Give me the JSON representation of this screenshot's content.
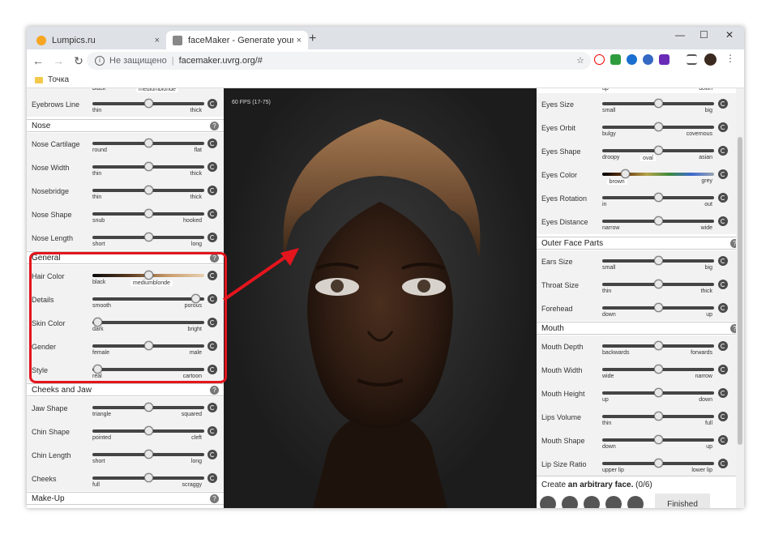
{
  "browser": {
    "tabs": [
      {
        "label": "Lumpics.ru",
        "close": "×"
      },
      {
        "label": "faceMaker - Generate your favou",
        "close": "×"
      }
    ],
    "new_tab": "+",
    "window_controls": {
      "minimize": "—",
      "maximize": "☐",
      "close": "✕"
    },
    "security_label": "Не защищено",
    "url": "facemaker.uvrg.org/#",
    "bookmark": "Точка"
  },
  "viewport": {
    "fps": "60 FPS (17-75)"
  },
  "left_panel": {
    "top_partial": {
      "lo": "black",
      "tooltip": "mediumblonde"
    },
    "eyebrows": {
      "name": "Eyebrows Line",
      "lo": "thin",
      "hi": "thick",
      "value": 0.5
    },
    "nose": {
      "title": "Nose",
      "rows": [
        {
          "name": "Nose Cartilage",
          "lo": "round",
          "hi": "flat",
          "value": 0.5
        },
        {
          "name": "Nose Width",
          "lo": "thin",
          "hi": "thick",
          "value": 0.5
        },
        {
          "name": "Nosebridge",
          "lo": "thin",
          "hi": "thick",
          "value": 0.5
        },
        {
          "name": "Nose Shape",
          "lo": "snub",
          "hi": "hooked",
          "value": 0.5
        },
        {
          "name": "Nose Length",
          "lo": "short",
          "hi": "long",
          "value": 0.5
        }
      ]
    },
    "general": {
      "title": "General",
      "rows": [
        {
          "name": "Hair Color",
          "lo": "black",
          "hi": "",
          "tooltip": "mediumblonde",
          "value": 0.5
        },
        {
          "name": "Details",
          "lo": "smooth",
          "hi": "porous",
          "value": 0.92
        },
        {
          "name": "Skin Color",
          "lo": "dark",
          "hi": "bright",
          "value": 0.04
        },
        {
          "name": "Gender",
          "lo": "female",
          "hi": "male",
          "value": 0.5
        },
        {
          "name": "Style",
          "lo": "real",
          "hi": "cartoon",
          "value": 0.04
        }
      ]
    },
    "cheeks": {
      "title": "Cheeks and Jaw",
      "rows": [
        {
          "name": "Jaw Shape",
          "lo": "triangle",
          "hi": "squared",
          "value": 0.5
        },
        {
          "name": "Chin Shape",
          "lo": "pointed",
          "hi": "cleft",
          "value": 0.5
        },
        {
          "name": "Chin Length",
          "lo": "short",
          "hi": "long",
          "value": 0.5
        },
        {
          "name": "Cheeks",
          "lo": "full",
          "hi": "scraggy",
          "value": 0.5
        }
      ]
    },
    "makeup": {
      "title": "Make-Up"
    }
  },
  "right_panel": {
    "top_partial": {
      "lo": "up",
      "hi": "down"
    },
    "eyes": {
      "rows": [
        {
          "name": "Eyes Size",
          "lo": "small",
          "hi": "big",
          "value": 0.5
        },
        {
          "name": "Eyes Orbit",
          "lo": "bulgy",
          "hi": "covernous",
          "value": 0.5
        },
        {
          "name": "Eyes Shape",
          "lo": "droopy",
          "hi": "asian",
          "value": 0.5,
          "tooltip": "oval"
        },
        {
          "name": "Eyes Color",
          "lo": "",
          "hi": "grey",
          "value": 0.2,
          "tooltip": "brown"
        },
        {
          "name": "Eyes Rotation",
          "lo": "in",
          "hi": "out",
          "value": 0.5
        },
        {
          "name": "Eyes Distance",
          "lo": "narrow",
          "hi": "wide",
          "value": 0.5
        }
      ]
    },
    "outer": {
      "title": "Outer Face Parts",
      "rows": [
        {
          "name": "Ears Size",
          "lo": "small",
          "hi": "big",
          "value": 0.5
        },
        {
          "name": "Throat Size",
          "lo": "thin",
          "hi": "thick",
          "value": 0.5
        },
        {
          "name": "Forehead",
          "lo": "down",
          "hi": "up",
          "value": 0.5
        }
      ]
    },
    "mouth": {
      "title": "Mouth",
      "rows": [
        {
          "name": "Mouth Depth",
          "lo": "backwards",
          "hi": "forwards",
          "value": 0.5
        },
        {
          "name": "Mouth Width",
          "lo": "wide",
          "hi": "narrow",
          "value": 0.5
        },
        {
          "name": "Mouth Height",
          "lo": "up",
          "hi": "down",
          "value": 0.5
        },
        {
          "name": "Lips Volume",
          "lo": "thin",
          "hi": "full",
          "value": 0.5
        },
        {
          "name": "Mouth Shape",
          "lo": "down",
          "hi": "up",
          "value": 0.5
        },
        {
          "name": "Lip Size Ratio",
          "lo": "upper lip",
          "hi": "lower lip",
          "value": 0.5
        }
      ]
    },
    "task": {
      "prefix": "Create ",
      "bold": "an arbitrary face.",
      "count": " (0/6)",
      "finished": "Finished"
    }
  }
}
